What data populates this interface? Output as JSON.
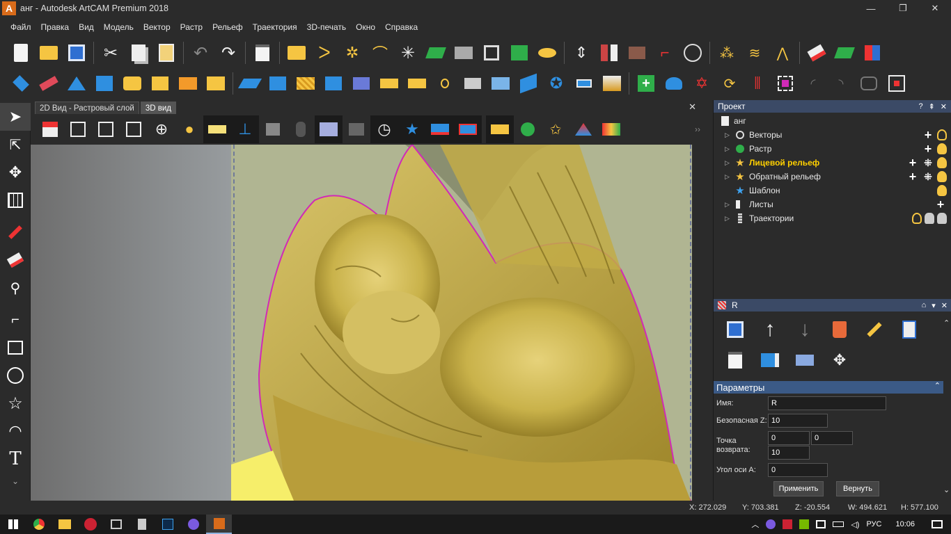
{
  "window": {
    "title": "анг - Autodesk ArtCAM Premium 2018",
    "logo_letter": "A",
    "minimize": "—",
    "maximize": "❐",
    "close": "✕"
  },
  "menu": [
    "Файл",
    "Правка",
    "Вид",
    "Модель",
    "Вектор",
    "Растр",
    "Рельеф",
    "Траектория",
    "3D-печать",
    "Окно",
    "Справка"
  ],
  "view": {
    "tabs": [
      {
        "label": "2D Вид - Растровый слой",
        "active": false
      },
      {
        "label": "3D вид",
        "active": true
      }
    ],
    "close": "✕",
    "more": "››"
  },
  "project": {
    "header": "Проект",
    "header_buttons": [
      "?",
      "⇞",
      "✕"
    ],
    "root": "анг",
    "items": [
      {
        "label": "Векторы",
        "bold": false
      },
      {
        "label": "Растр",
        "bold": false
      },
      {
        "label": "Лицевой рельеф",
        "bold": true
      },
      {
        "label": "Обратный рельеф",
        "bold": false
      },
      {
        "label": "Шаблон",
        "bold": false
      },
      {
        "label": "Листы",
        "bold": false
      },
      {
        "label": "Траектории",
        "bold": false
      }
    ]
  },
  "toolpath": {
    "header": "R",
    "header_buttons": [
      "⌂",
      "▾",
      "✕"
    ]
  },
  "params": {
    "header": "Параметры",
    "name_label": "Имя:",
    "name_value": "R",
    "safe_z_label": "Безопасная Z:",
    "safe_z_value": "10",
    "return_label": "Точка возврата:",
    "return_x": "0",
    "return_y": "0",
    "return_z": "10",
    "axis_label": "Угол оси A:",
    "axis_value": "0",
    "apply": "Применить",
    "revert": "Вернуть"
  },
  "status": {
    "x": "X: 272.029",
    "y": "Y: 703.381",
    "z": "Z: -20.554",
    "w": "W: 494.621",
    "h": "H: 577.100"
  },
  "taskbar": {
    "lang": "РУС",
    "time": "10:06"
  },
  "colors": {
    "model_gold": "#c9b24a",
    "panel_header": "#3b4a66",
    "bold_item": "#ffd000"
  }
}
